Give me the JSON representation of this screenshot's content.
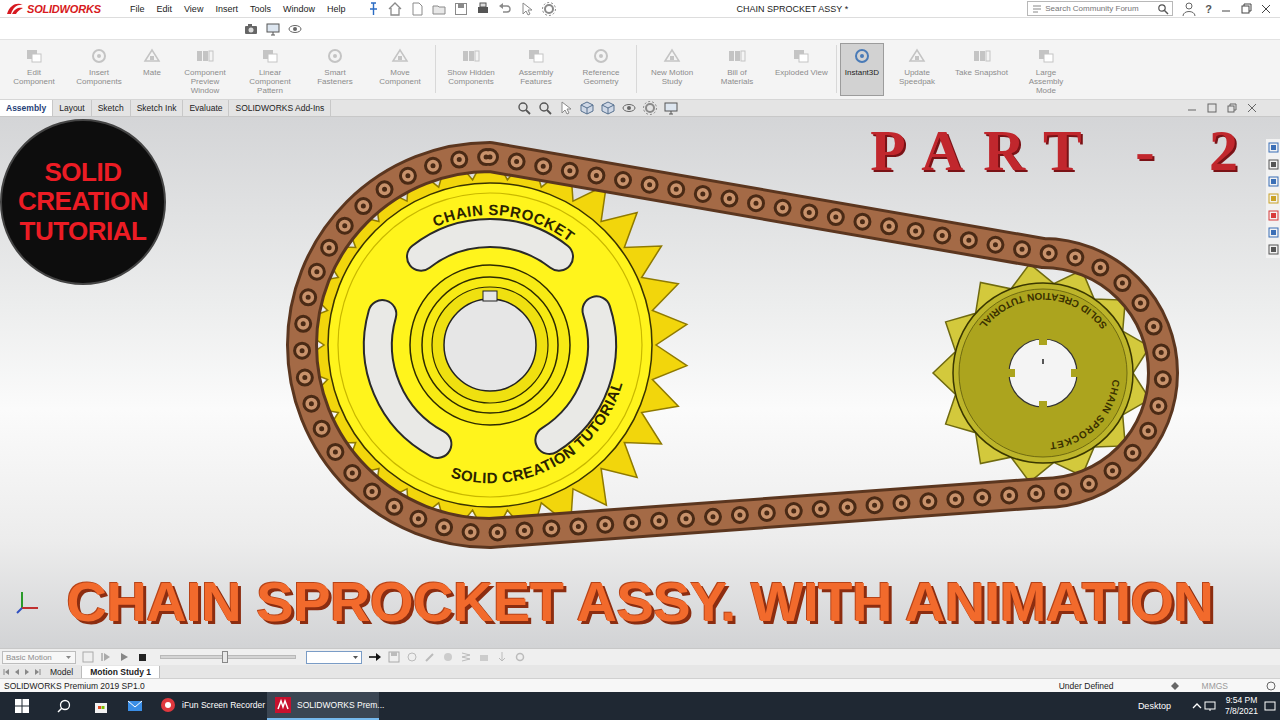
{
  "app": {
    "logo": "SOLIDWORKS",
    "title": "CHAIN SPROCKET ASSY *"
  },
  "menu": [
    "File",
    "Edit",
    "View",
    "Insert",
    "Tools",
    "Window",
    "Help"
  ],
  "search": {
    "placeholder": "Search Community Forum"
  },
  "help": "?",
  "ribbon": [
    {
      "label": "Edit Component",
      "disabled": true,
      "selected": false
    },
    {
      "label": "Insert Components",
      "disabled": true,
      "selected": false
    },
    {
      "label": "Mate",
      "disabled": true,
      "selected": false
    },
    {
      "label": "Component Preview Window",
      "disabled": true,
      "selected": false
    },
    {
      "label": "Linear Component Pattern",
      "disabled": true,
      "selected": false
    },
    {
      "label": "Smart Fasteners",
      "disabled": true,
      "selected": false
    },
    {
      "label": "Move Component",
      "disabled": true,
      "selected": false
    },
    {
      "label": "Show Hidden Components",
      "disabled": true,
      "selected": false
    },
    {
      "label": "Assembly Features",
      "disabled": true,
      "selected": false
    },
    {
      "label": "Reference Geometry",
      "disabled": true,
      "selected": false
    },
    {
      "label": "New Motion Study",
      "disabled": true,
      "selected": false
    },
    {
      "label": "Bill of Materials",
      "disabled": true,
      "selected": false
    },
    {
      "label": "Exploded View",
      "disabled": true,
      "selected": false
    },
    {
      "label": "Instant3D",
      "disabled": false,
      "selected": true
    },
    {
      "label": "Update Speedpak",
      "disabled": true,
      "selected": false
    },
    {
      "label": "Take Snapshot",
      "disabled": true,
      "selected": false
    },
    {
      "label": "Large Assembly Mode",
      "disabled": true,
      "selected": false
    }
  ],
  "tabs": [
    {
      "label": "Assembly",
      "selected": true
    },
    {
      "label": "Layout",
      "selected": false
    },
    {
      "label": "Sketch",
      "selected": false
    },
    {
      "label": "Sketch Ink",
      "selected": false
    },
    {
      "label": "Evaluate",
      "selected": false
    },
    {
      "label": "SOLIDWORKS Add-Ins",
      "selected": false
    }
  ],
  "overlay": {
    "badge": "SOLID CREATION TUTORIAL",
    "part": "PART - 2",
    "headline": "CHAIN SPROCKET ASSY. WITH ANIMATION"
  },
  "model": {
    "large_sprocket": [
      "CHAIN SPROCKET",
      "SOLID CREATION TUTORIAL"
    ],
    "small_sprocket": [
      "SOLID CREATION TUTORIAL",
      "CHAIN SPROCKET"
    ]
  },
  "motion": {
    "study_type": "Basic Motion",
    "timeline": {
      "level": 0.48
    }
  },
  "bottom_tabs": [
    {
      "label": "Model",
      "selected": false
    },
    {
      "label": "Motion Study 1",
      "selected": true
    }
  ],
  "status_bar": {
    "version": "SOLIDWORKS Premium 2019 SP1.0",
    "state": "Under Defined",
    "units": "MMGS"
  },
  "taskbar": {
    "apps": [
      {
        "label": "iFun Screen Recorder",
        "selected": false
      },
      {
        "label": "SOLIDWORKS Prem...",
        "selected": true
      }
    ],
    "desktop": "Desktop",
    "time": "9:54 PM",
    "date": "7/8/2021"
  }
}
